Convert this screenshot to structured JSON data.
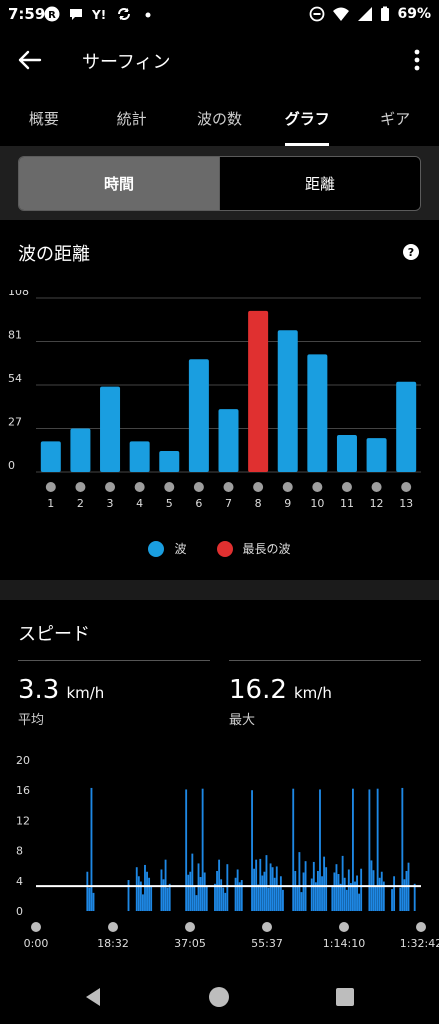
{
  "status": {
    "time": "7:59",
    "battery": "69%"
  },
  "app_bar": {
    "title": "サーフィン"
  },
  "tabs": [
    {
      "label": "概要"
    },
    {
      "label": "統計"
    },
    {
      "label": "波の数"
    },
    {
      "label": "グラフ",
      "active": true
    },
    {
      "label": "ギア"
    }
  ],
  "toggle": {
    "options": [
      {
        "label": "時間",
        "active": true
      },
      {
        "label": "距離",
        "active": false
      }
    ]
  },
  "wave_distance": {
    "title": "波の距離",
    "help": "?",
    "legend": [
      {
        "label": "波",
        "color": "#1a9ee0"
      },
      {
        "label": "最長の波",
        "color": "#e03030"
      }
    ]
  },
  "speed": {
    "title": "スピード",
    "avg": {
      "value": "3.3",
      "unit": "km/h",
      "label": "平均"
    },
    "max": {
      "value": "16.2",
      "unit": "km/h",
      "label": "最大"
    }
  },
  "chart_data": [
    {
      "type": "bar",
      "title": "波の距離",
      "categories": [
        "1",
        "2",
        "3",
        "4",
        "5",
        "6",
        "7",
        "8",
        "9",
        "10",
        "11",
        "12",
        "13"
      ],
      "values": [
        19,
        27,
        53,
        19,
        13,
        70,
        39,
        100,
        88,
        73,
        23,
        21,
        56
      ],
      "highlight_index": 7,
      "colors": {
        "bar": "#1a9ee0",
        "highlight": "#e03030",
        "grid": "#444444",
        "dot": "#9e9e9e"
      },
      "yticks": [
        0,
        27,
        54,
        81,
        108
      ],
      "ylim": [
        0,
        108
      ],
      "grid": true,
      "legend_position": "bottom"
    },
    {
      "type": "bar",
      "title": "スピード",
      "yticks": [
        0,
        4,
        8,
        12,
        16,
        20
      ],
      "ylim": [
        0,
        20
      ],
      "xticks": [
        "0:00",
        "18:32",
        "37:05",
        "55:37",
        "1:14:10",
        "1:32:42"
      ],
      "average_line": 3.3,
      "colors": {
        "bar": "#1e88e5",
        "avg_line": "#ffffff",
        "dot": "#bdbdbd"
      },
      "grid": false,
      "values": [
        0,
        0,
        0,
        0,
        0,
        0,
        0,
        0,
        0,
        0,
        0,
        0,
        0,
        0,
        0,
        0,
        0,
        0,
        0,
        0,
        0,
        0,
        0,
        0,
        5.2,
        3.1,
        16.3,
        2.4,
        0,
        0,
        0,
        0,
        0,
        0,
        0,
        0,
        0,
        0,
        0,
        0,
        0,
        0,
        0,
        0,
        4.1,
        0,
        0,
        0,
        5.8,
        4.6,
        3.9,
        2.2,
        6.1,
        5.2,
        4.4,
        3.3,
        0,
        0,
        0,
        0,
        5.5,
        4.2,
        6.8,
        3.1,
        3.6,
        0,
        0,
        0,
        0,
        0,
        0,
        0,
        16.1,
        4.8,
        5.2,
        7.6,
        3.2,
        2.1,
        6.3,
        4.5,
        16.2,
        5.1,
        3.3,
        0,
        0,
        0,
        3.6,
        5.3,
        6.8,
        4.2,
        3.1,
        2.4,
        6.2,
        0,
        0,
        0,
        4.4,
        5.5,
        3.8,
        4.1,
        0,
        0,
        0,
        0,
        16.0,
        5.6,
        6.8,
        3.5,
        6.9,
        4.7,
        5.2,
        7.4,
        3.1,
        6.3,
        5.8,
        4.4,
        5.9,
        3.2,
        4.6,
        2.8,
        0,
        0,
        0,
        0,
        16.2,
        5.3,
        3.4,
        7.8,
        2.5,
        5.1,
        6.6,
        0,
        0,
        4.3,
        6.5,
        3.8,
        5.3,
        16.1,
        4.6,
        7.2,
        5.8,
        0,
        0,
        3.4,
        5.1,
        6.2,
        4.9,
        3.6,
        7.3,
        4.4,
        2.8,
        5.5,
        3.7,
        16.2,
        3.9,
        4.7,
        2.3,
        5.6,
        0,
        0,
        0,
        16.1,
        6.7,
        5.4,
        3.3,
        16.2,
        4.4,
        5.2,
        3.9,
        0,
        0,
        0,
        2.9,
        4.6,
        0,
        0,
        3.1,
        16.3,
        4.2,
        5.3,
        6.4,
        0,
        0,
        3.6,
        0,
        0,
        0
      ]
    }
  ],
  "nav": {
    "back": "back-triangle",
    "home": "home-circle",
    "recents": "recents-square"
  }
}
